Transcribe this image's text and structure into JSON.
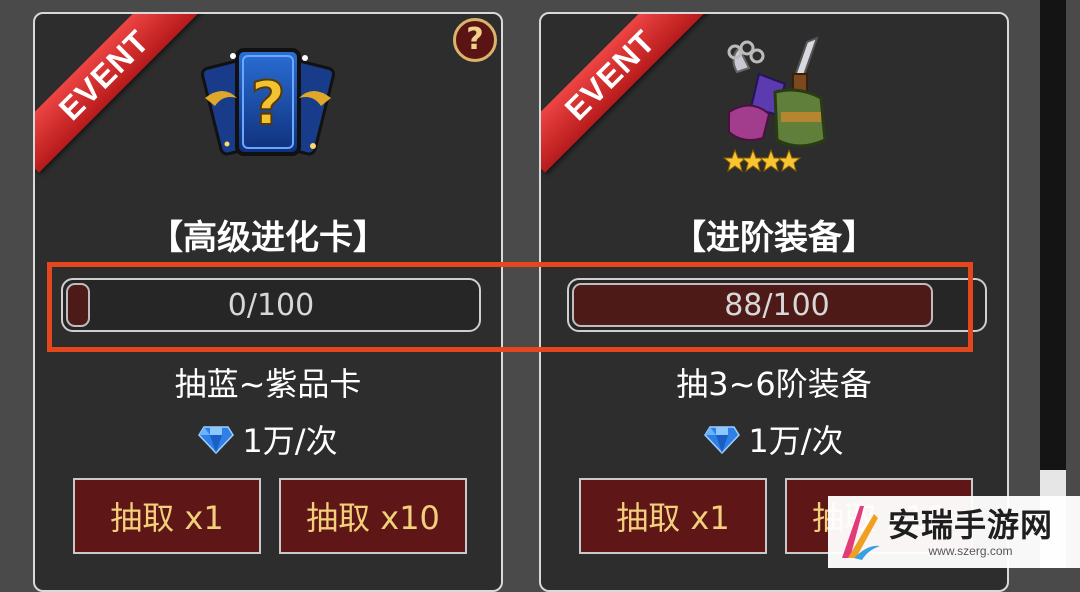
{
  "cards": [
    {
      "ribbon": "EVENT",
      "has_help": true,
      "help_label": "?",
      "image_icon": "mystery-card-icon",
      "title": "【高级进化卡】",
      "progress_current": 0,
      "progress_max": 100,
      "progress_text": "0/100",
      "description": "抽蓝~紫品卡",
      "cost_icon": "diamond-icon",
      "cost": "1万/次",
      "btn1": "抽取 x1",
      "btn2": "抽取 x10"
    },
    {
      "ribbon": "EVENT",
      "has_help": false,
      "image_icon": "equipment-set-icon",
      "title": "【进阶装备】",
      "progress_current": 88,
      "progress_max": 100,
      "progress_text": "88/100",
      "description": "抽3~6阶装备",
      "cost_icon": "diamond-icon",
      "cost": "1万/次",
      "btn1": "抽取 x1",
      "btn2": "抽取 x10"
    }
  ],
  "watermark": {
    "name": "安瑞手游网",
    "url": "www.szerg.com"
  },
  "colors": {
    "ribbon": "#d62828",
    "button_bg": "#5e1616",
    "button_text": "#f2cf7a",
    "highlight": "#e4461d",
    "progress_fill": "#4e1a18"
  }
}
